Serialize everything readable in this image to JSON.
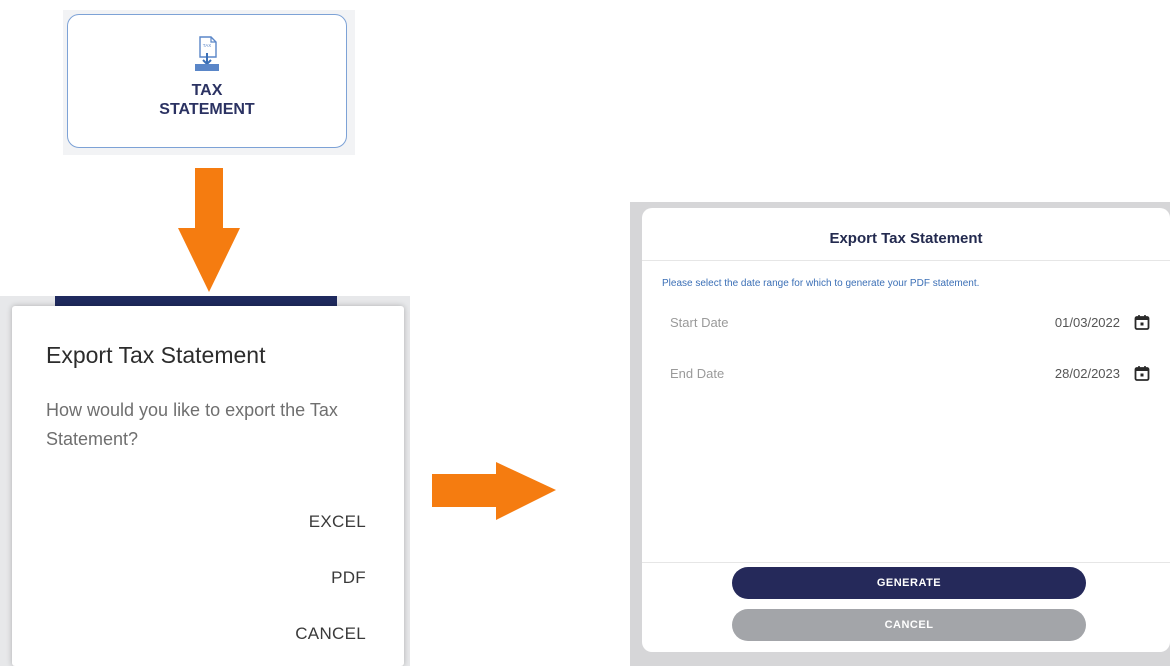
{
  "tile": {
    "icon": "document-download-icon",
    "icon_badge": "TAX",
    "label_line1": "TAX",
    "label_line2": "STATEMENT"
  },
  "export_dialog": {
    "title": "Export Tax Statement",
    "message": "How would you like to export the Tax Statement?",
    "actions": {
      "excel": "EXCEL",
      "pdf": "PDF",
      "cancel": "CANCEL"
    }
  },
  "date_dialog": {
    "title": "Export Tax Statement",
    "instruction": "Please select the date range for which to generate your PDF statement.",
    "start_date": {
      "label": "Start Date",
      "value": "01/03/2022",
      "icon": "calendar-icon"
    },
    "end_date": {
      "label": "End Date",
      "value": "28/02/2023",
      "icon": "calendar-icon"
    },
    "generate_label": "GENERATE",
    "cancel_label": "CANCEL"
  },
  "colors": {
    "arrow": "#f57c10",
    "navy": "#25295a",
    "tile_border": "#7da2d6",
    "link_blue": "#3b6fb6",
    "cancel_grey": "#a3a5a9"
  }
}
